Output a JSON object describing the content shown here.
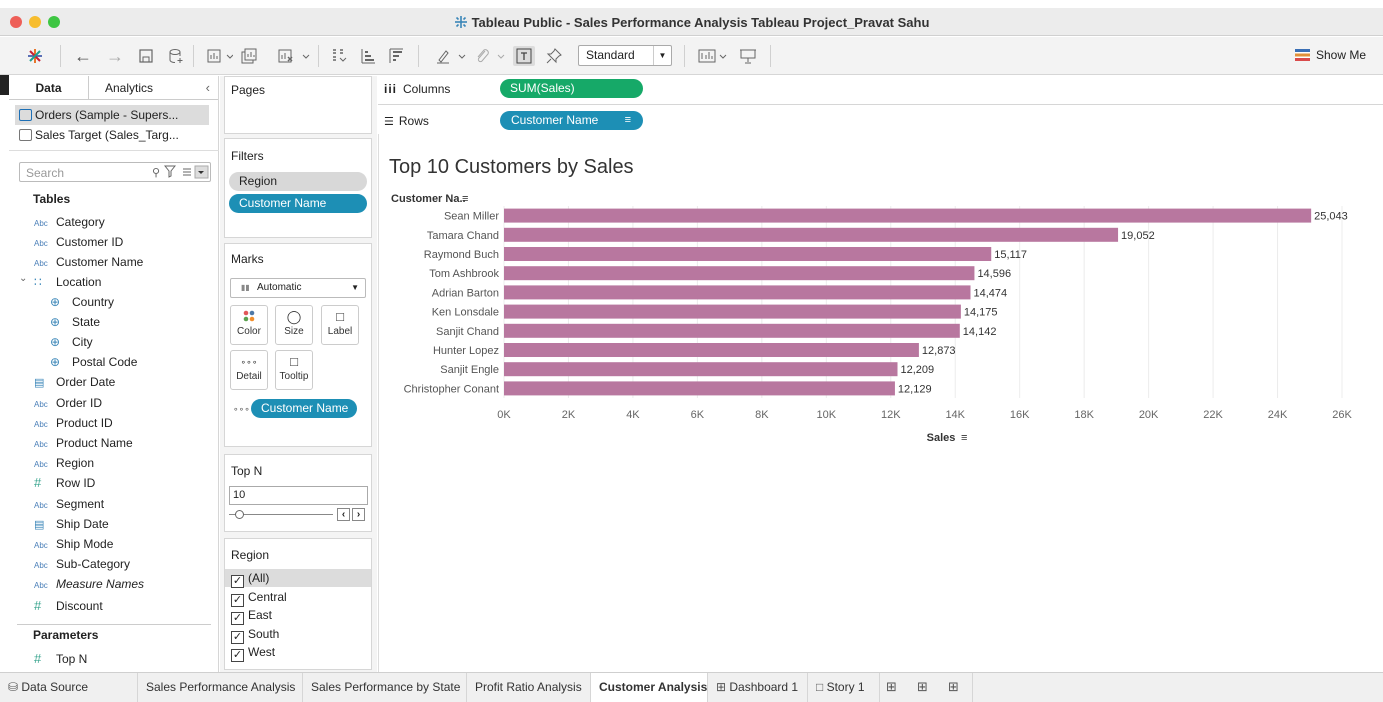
{
  "window": {
    "title": "Tableau Public - Sales Performance Analysis Tableau Project_Pravat Sahu"
  },
  "toolbar": {
    "fit_select": "Standard",
    "show_me": "Show Me"
  },
  "data_pane": {
    "tabs": [
      "Data",
      "Analytics"
    ],
    "datasources": [
      "Orders (Sample - Supers...",
      "Sales Target (Sales_Targ..."
    ],
    "search_placeholder": "Search",
    "tables_heading": "Tables",
    "fields": [
      {
        "type": "Abc",
        "label": "Category"
      },
      {
        "type": "Abc",
        "label": "Customer ID"
      },
      {
        "type": "Abc",
        "label": "Customer Name"
      },
      {
        "type": "hier",
        "label": "Location"
      },
      {
        "type": "globe",
        "label": "Country"
      },
      {
        "type": "globe",
        "label": "State"
      },
      {
        "type": "globe",
        "label": "City"
      },
      {
        "type": "globe",
        "label": "Postal Code"
      },
      {
        "type": "date",
        "label": "Order Date"
      },
      {
        "type": "Abc",
        "label": "Order ID"
      },
      {
        "type": "Abc",
        "label": "Product ID"
      },
      {
        "type": "Abc",
        "label": "Product Name"
      },
      {
        "type": "Abc",
        "label": "Region"
      },
      {
        "type": "#",
        "label": "Row ID"
      },
      {
        "type": "Abc",
        "label": "Segment"
      },
      {
        "type": "date",
        "label": "Ship Date"
      },
      {
        "type": "Abc",
        "label": "Ship Mode"
      },
      {
        "type": "Abc",
        "label": "Sub-Category"
      },
      {
        "type": "Abc",
        "label": "Measure Names"
      },
      {
        "type": "#",
        "label": "Discount"
      }
    ],
    "parameters_heading": "Parameters",
    "parameters": [
      {
        "type": "#",
        "label": "Top N"
      }
    ]
  },
  "pages": {
    "heading": "Pages"
  },
  "filters": {
    "heading": "Filters",
    "items": [
      "Region",
      "Customer Name"
    ]
  },
  "marks": {
    "heading": "Marks",
    "type": "Automatic",
    "buttons": [
      "Color",
      "Size",
      "Label",
      "Detail",
      "Tooltip"
    ],
    "detail_pill": "Customer Name"
  },
  "topn": {
    "heading": "Top N",
    "value": "10"
  },
  "region_filter": {
    "heading": "Region",
    "options": [
      {
        "label": "(All)",
        "checked": true
      },
      {
        "label": "Central",
        "checked": true
      },
      {
        "label": "East",
        "checked": true
      },
      {
        "label": "South",
        "checked": true
      },
      {
        "label": "West",
        "checked": true
      }
    ]
  },
  "shelves": {
    "columns_label": "Columns",
    "columns_pill": "SUM(Sales)",
    "rows_label": "Rows",
    "rows_pill": "Customer Name"
  },
  "chart_data": {
    "type": "bar",
    "orientation": "horizontal",
    "title": "Top 10 Customers by Sales",
    "ylabel": "Customer Na..",
    "xlabel": "Sales",
    "categories": [
      "Sean Miller",
      "Tamara Chand",
      "Raymond Buch",
      "Tom Ashbrook",
      "Adrian Barton",
      "Ken Lonsdale",
      "Sanjit Chand",
      "Hunter Lopez",
      "Sanjit Engle",
      "Christopher Conant"
    ],
    "values": [
      25043,
      19052,
      15117,
      14596,
      14474,
      14175,
      14142,
      12873,
      12209,
      12129
    ],
    "value_labels": [
      "25,043",
      "19,052",
      "15,117",
      "14,596",
      "14,474",
      "14,175",
      "14,142",
      "12,873",
      "12,209",
      "12,129"
    ],
    "xlim": [
      0,
      26000
    ],
    "xticks": [
      "0K",
      "2K",
      "4K",
      "6K",
      "8K",
      "10K",
      "12K",
      "14K",
      "16K",
      "18K",
      "20K",
      "22K",
      "24K",
      "26K"
    ],
    "grid": true,
    "bar_color": "#b8779f"
  },
  "sheet_tabs": [
    "Data Source",
    "Sales Performance Analysis",
    "Sales Performance by State",
    "Profit Ratio Analysis",
    "Customer Analysis",
    "Dashboard 1",
    "Story 1"
  ],
  "active_sheet": "Customer Analysis"
}
